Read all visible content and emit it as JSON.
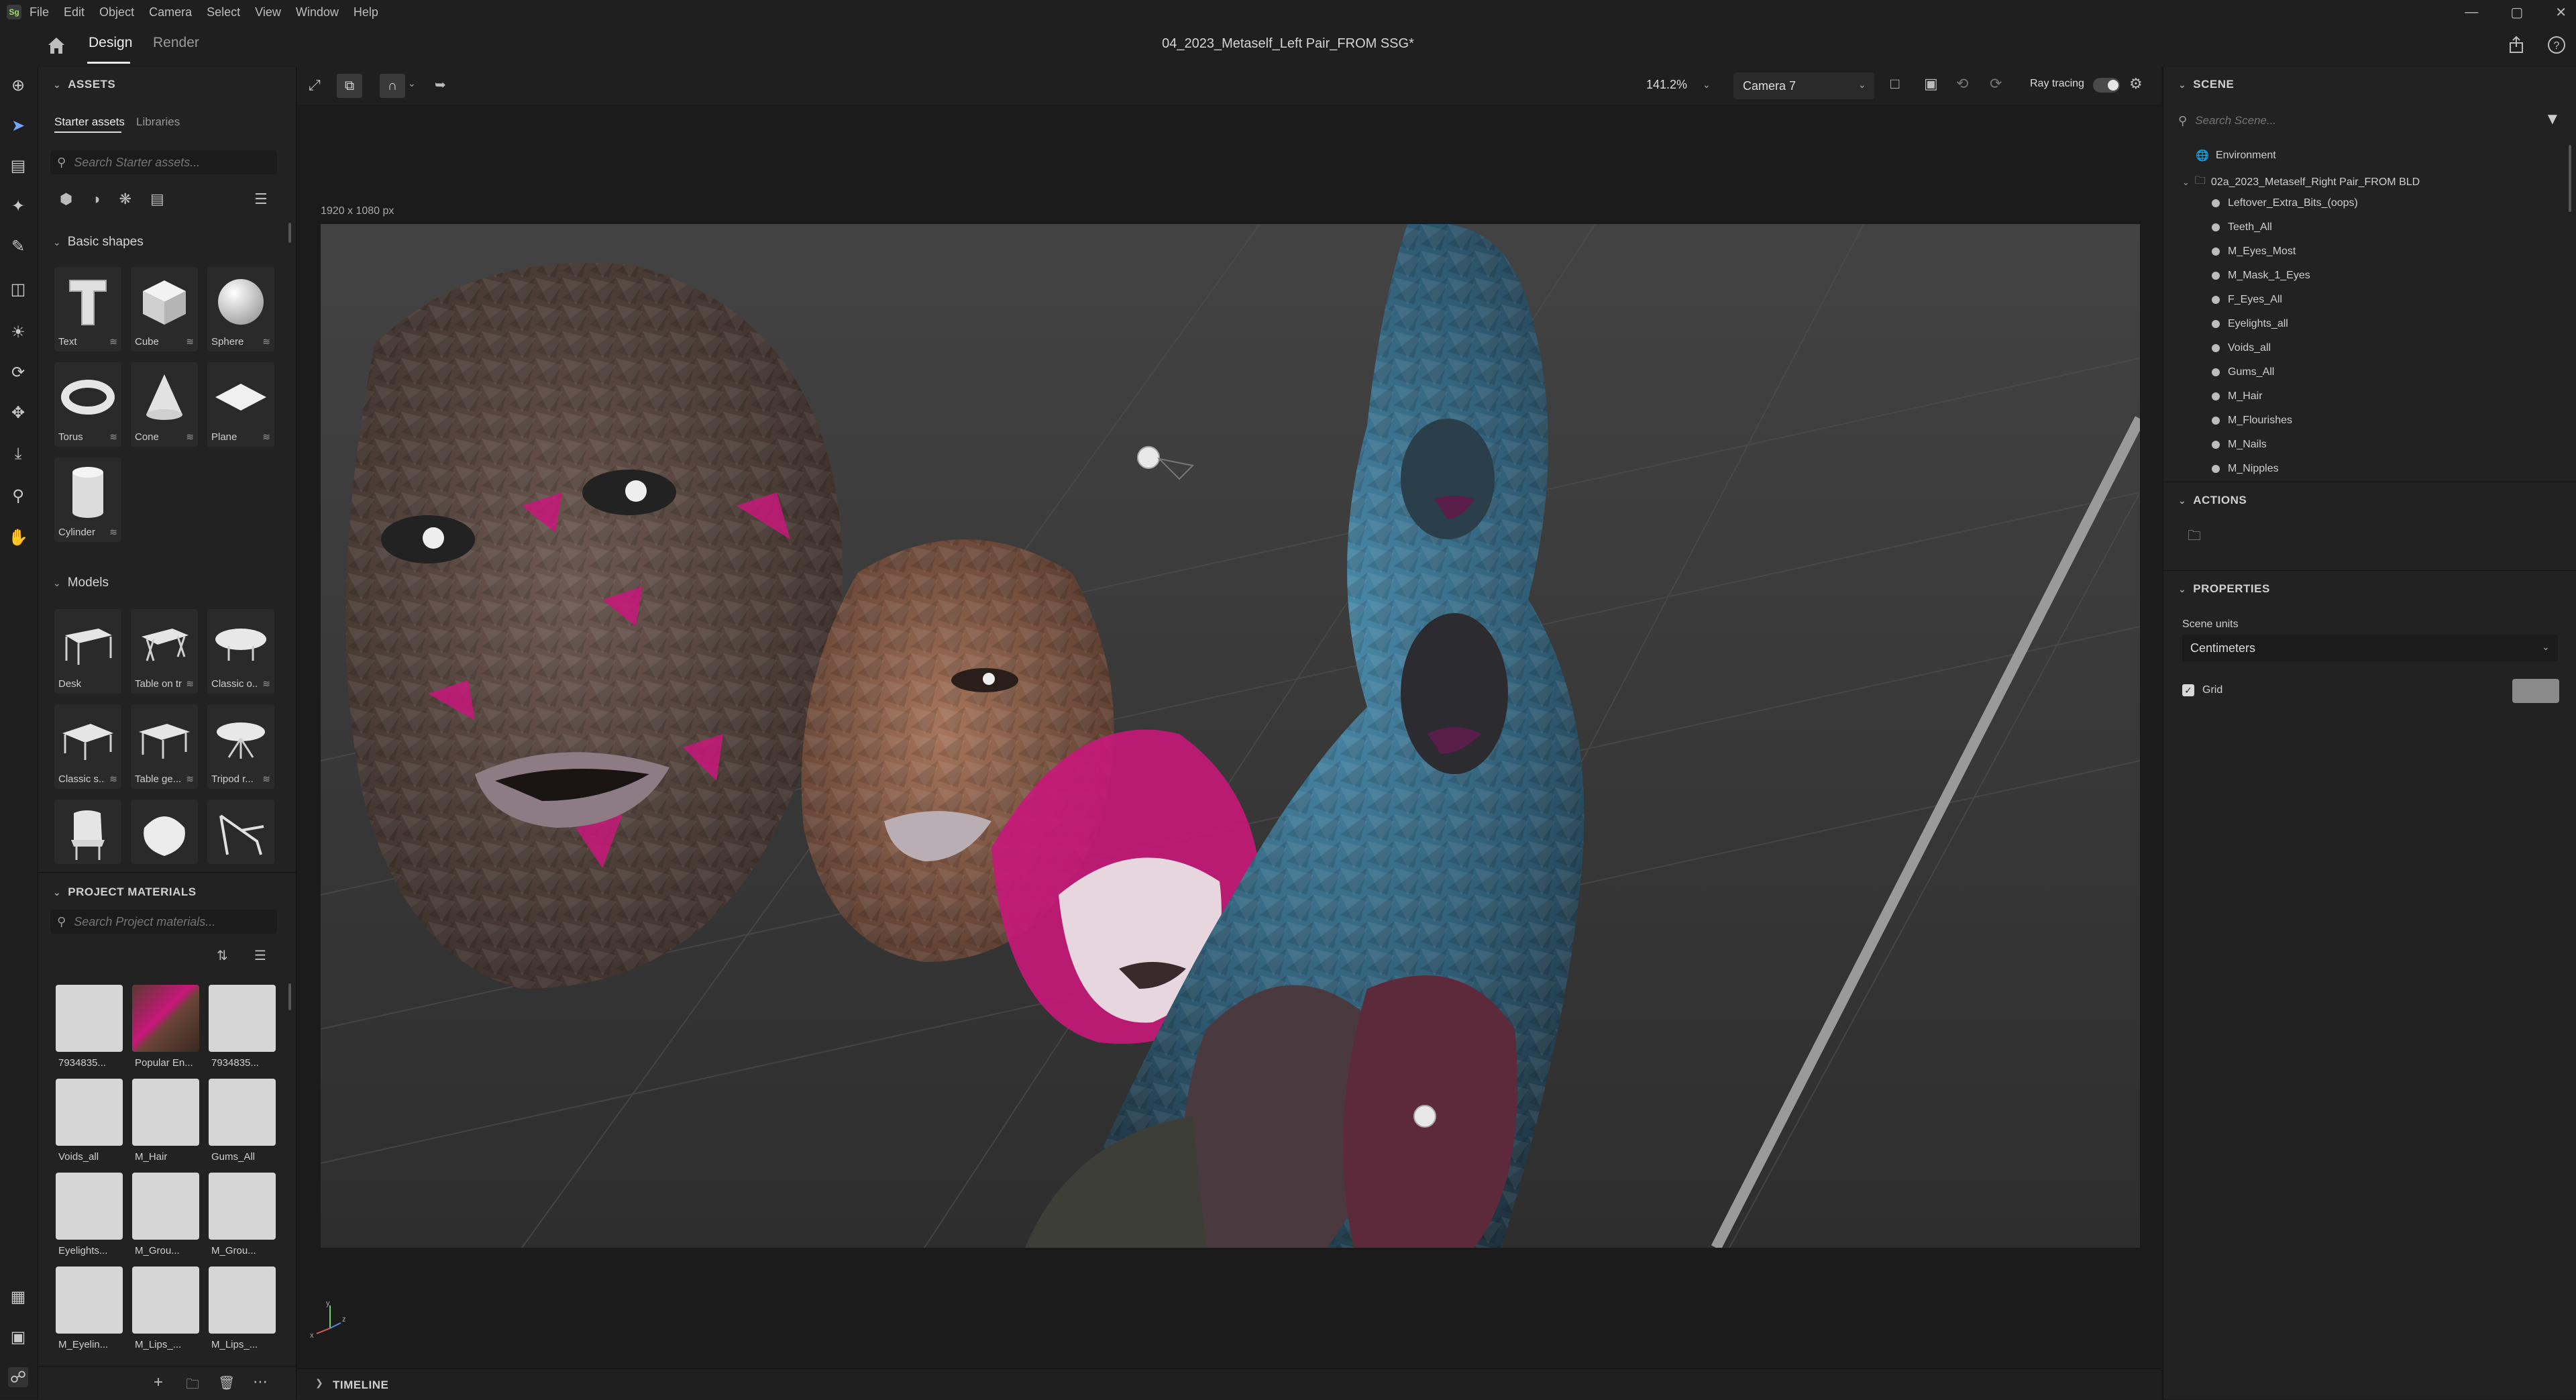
{
  "menu": {
    "items": [
      "File",
      "Edit",
      "Object",
      "Camera",
      "Select",
      "View",
      "Window",
      "Help"
    ]
  },
  "titlebar": {
    "tabs": [
      {
        "label": "Design"
      },
      {
        "label": "Render"
      }
    ],
    "document_title": "04_2023_Metaself_Left Pair_FROM SSG*"
  },
  "assets": {
    "header": "ASSETS",
    "tabs": [
      "Starter assets",
      "Libraries"
    ],
    "search_placeholder": "Search Starter assets...",
    "basic_shapes": {
      "header": "Basic shapes",
      "items": [
        "Text",
        "Cube",
        "Sphere",
        "Torus",
        "Cone",
        "Plane",
        "Cylinder"
      ]
    },
    "models": {
      "header": "Models",
      "items": [
        "Desk",
        "Table on tr...",
        "Classic o...",
        "Classic s...",
        "Table ge...",
        "Tripod r...",
        "",
        "",
        ""
      ]
    }
  },
  "project_materials": {
    "header": "PROJECT MATERIALS",
    "search_placeholder": "Search Project materials...",
    "items": [
      "7934835...",
      "Popular En...",
      "7934835...",
      "Voids_all",
      "M_Hair",
      "Gums_All",
      "Eyelights...",
      "M_Grou...",
      "M_Grou...",
      "M_Eyelin...",
      "M_Lips_...",
      "M_Lips_..."
    ]
  },
  "viewport": {
    "zoom": "141.2%",
    "camera": "Camera 7",
    "ray_tracing_label": "Ray tracing",
    "resolution": "1920 x 1080 px",
    "axis_labels": {
      "x": "x",
      "y": "y",
      "z": "z"
    }
  },
  "timeline": {
    "label": "TIMELINE"
  },
  "scene": {
    "header": "SCENE",
    "search_placeholder": "Search Scene...",
    "environment": "Environment",
    "group": "02a_2023_Metaself_Right Pair_FROM BLD",
    "items": [
      "Leftover_Extra_Bits_(oops)",
      "Teeth_All",
      "M_Eyes_Most",
      "M_Mask_1_Eyes",
      "F_Eyes_All",
      "Eyelights_all",
      "Voids_all",
      "Gums_All",
      "M_Hair",
      "M_Flourishes",
      "M_Nails",
      "M_Nipples"
    ]
  },
  "actions": {
    "header": "ACTIONS"
  },
  "properties": {
    "header": "PROPERTIES",
    "scene_units_label": "Scene units",
    "scene_units_value": "Centimeters",
    "grid_label": "Grid"
  },
  "colors": {
    "accent": "#e8e8e8",
    "panel": "#222222",
    "viewport_bg": "#3c3c3c",
    "magenta": "#c8187a"
  }
}
